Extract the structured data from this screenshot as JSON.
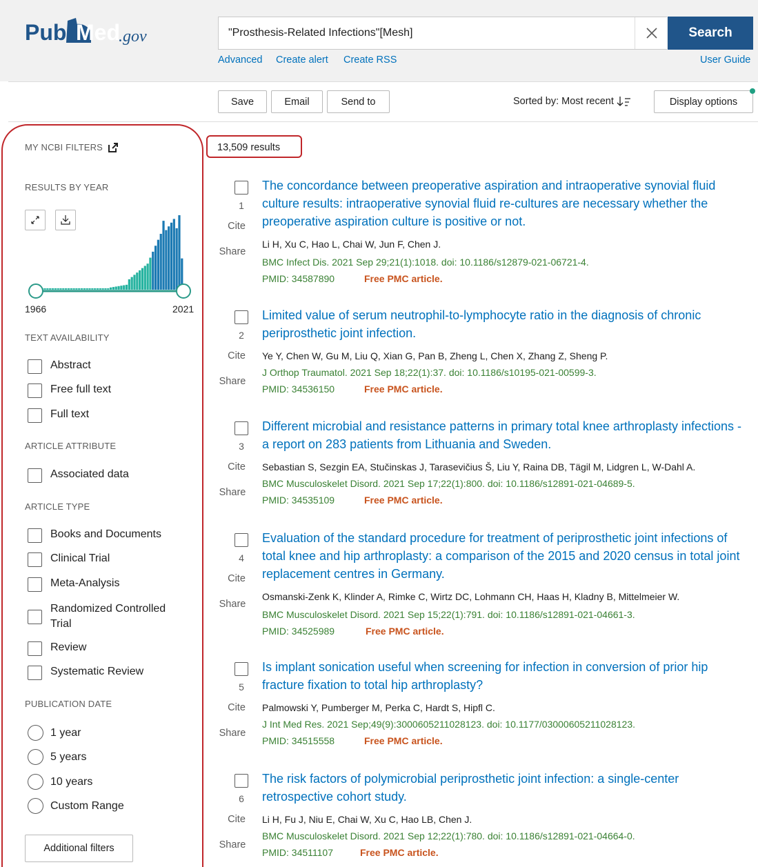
{
  "colors": {
    "header_bg": "#f1f1f1",
    "brand_blue": "#20558a",
    "link_blue": "#0071bc",
    "citation_green": "#3a8134",
    "free_orange": "#c8531d",
    "highlight_red": "#c0262a",
    "histogram_bar_dark": "#1c7ab3",
    "histogram_bar_light": "#26b3a0"
  },
  "header": {
    "logo_text_pub": "Pub",
    "logo_text_med": "Med",
    "logo_text_gov": ".gov",
    "search_value": "\"Prosthesis-Related Infections\"[Mesh]",
    "search_button": "Search",
    "links": {
      "advanced": "Advanced",
      "create_alert": "Create alert",
      "create_rss": "Create RSS",
      "user_guide": "User Guide"
    }
  },
  "toolbar": {
    "save": "Save",
    "email": "Email",
    "send_to": "Send to",
    "sorted_by": "Sorted by: Most recent",
    "display_options": "Display options"
  },
  "sidebar": {
    "my_ncbi_filters": "MY NCBI FILTERS",
    "results_by_year": "RESULTS BY YEAR",
    "year_start": "1966",
    "year_end": "2021",
    "text_availability": {
      "heading": "TEXT AVAILABILITY",
      "options": [
        "Abstract",
        "Free full text",
        "Full text"
      ]
    },
    "article_attribute": {
      "heading": "ARTICLE ATTRIBUTE",
      "options": [
        "Associated data"
      ]
    },
    "article_type": {
      "heading": "ARTICLE TYPE",
      "options": [
        "Books and Documents",
        "Clinical Trial",
        "Meta-Analysis",
        "Randomized Controlled Trial",
        "Review",
        "Systematic Review"
      ]
    },
    "publication_date": {
      "heading": "PUBLICATION DATE",
      "options": [
        "1 year",
        "5 years",
        "10 years",
        "Custom Range"
      ]
    },
    "additional_filters": "Additional filters"
  },
  "results_count": "13,509 results",
  "labels": {
    "cite": "Cite",
    "share": "Share"
  },
  "results": [
    {
      "num": "1",
      "title": "The concordance between preoperative aspiration and intraoperative synovial fluid culture results: intraoperative synovial fluid re-cultures are necessary whether the preoperative aspiration culture is positive or not.",
      "authors": "Li H, Xu C, Hao L, Chai W, Jun F, Chen J.",
      "citation": "BMC Infect Dis. 2021 Sep 29;21(1):1018. doi: 10.1186/s12879-021-06721-4.",
      "pmid": "PMID: 34587890",
      "free": "Free PMC article."
    },
    {
      "num": "2",
      "title": "Limited value of serum neutrophil-to-lymphocyte ratio in the diagnosis of chronic periprosthetic joint infection.",
      "authors": "Ye Y, Chen W, Gu M, Liu Q, Xian G, Pan B, Zheng L, Chen X, Zhang Z, Sheng P.",
      "citation": "J Orthop Traumatol. 2021 Sep 18;22(1):37. doi: 10.1186/s10195-021-00599-3.",
      "pmid": "PMID: 34536150",
      "free": "Free PMC article."
    },
    {
      "num": "3",
      "title": "Different microbial and resistance patterns in primary total knee arthroplasty infections - a report on 283 patients from Lithuania and Sweden.",
      "authors": "Sebastian S, Sezgin EA, Stučinskas J, Tarasevičius Š, Liu Y, Raina DB, Tägil M, Lidgren L, W-Dahl A.",
      "citation": "BMC Musculoskelet Disord. 2021 Sep 17;22(1):800. doi: 10.1186/s12891-021-04689-5.",
      "pmid": "PMID: 34535109",
      "free": "Free PMC article."
    },
    {
      "num": "4",
      "title": "Evaluation of the standard procedure for treatment of periprosthetic joint infections of total knee and hip arthroplasty: a comparison of the 2015 and 2020 census in total joint replacement centres in Germany.",
      "authors": "Osmanski-Zenk K, Klinder A, Rimke C, Wirtz DC, Lohmann CH, Haas H, Kladny B, Mittelmeier W.",
      "citation": "BMC Musculoskelet Disord. 2021 Sep 15;22(1):791. doi: 10.1186/s12891-021-04661-3.",
      "pmid": "PMID: 34525989",
      "free": "Free PMC article."
    },
    {
      "num": "5",
      "title": "Is implant sonication useful when screening for infection in conversion of prior hip fracture fixation to total hip arthroplasty?",
      "authors": "Palmowski Y, Pumberger M, Perka C, Hardt S, Hipfl C.",
      "citation": "J Int Med Res. 2021 Sep;49(9):3000605211028123. doi: 10.1177/03000605211028123.",
      "pmid": "PMID: 34515558",
      "free": "Free PMC article."
    },
    {
      "num": "6",
      "title": "The risk factors of polymicrobial periprosthetic joint infection: a single-center retrospective cohort study.",
      "authors": "Li H, Fu J, Niu E, Chai W, Xu C, Hao LB, Chen J.",
      "citation": "BMC Musculoskelet Disord. 2021 Sep 12;22(1):780. doi: 10.1186/s12891-021-04664-0.",
      "pmid": "PMID: 34511107",
      "free": "Free PMC article."
    }
  ]
}
